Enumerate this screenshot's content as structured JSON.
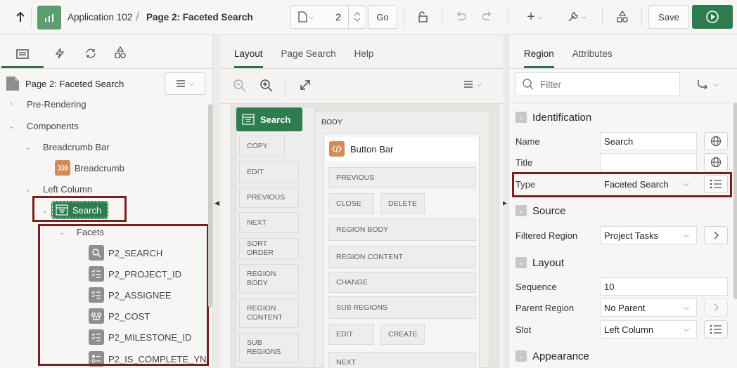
{
  "toolbar": {
    "app_name": "Application 102",
    "page_title": "Page 2: Faceted Search",
    "page_number": "2",
    "go_label": "Go",
    "save_label": "Save"
  },
  "left": {
    "tabs": [
      "rendering-icon",
      "dynamic-actions-icon",
      "processing-icon",
      "shared-components-icon"
    ],
    "root_label": "Page 2: Faceted Search",
    "tree": {
      "pre_rendering": "Pre-Rendering",
      "components": "Components",
      "breadcrumb_bar": "Breadcrumb Bar",
      "breadcrumb": "Breadcrumb",
      "left_column": "Left Column",
      "search": "Search",
      "facets": "Facets",
      "facet_items": [
        "P2_SEARCH",
        "P2_PROJECT_ID",
        "P2_ASSIGNEE",
        "P2_COST",
        "P2_MILESTONE_ID",
        "P2_IS_COMPLETE_YN"
      ]
    }
  },
  "center": {
    "tabs": [
      "Layout",
      "Page Search",
      "Help"
    ],
    "search_region": "Search",
    "search_slots": [
      "COPY",
      "EDIT",
      "PREVIOUS",
      "NEXT",
      "SORT ORDER",
      "REGION BODY",
      "REGION CONTENT",
      "SUB REGIONS"
    ],
    "body_label": "BODY",
    "button_bar": "Button Bar",
    "button_bar_slots": {
      "previous": "PREVIOUS",
      "close": "CLOSE",
      "delete": "DELETE",
      "region_body": "REGION BODY",
      "region_content": "REGION CONTENT",
      "change": "CHANGE",
      "sub_regions": "SUB REGIONS",
      "edit": "EDIT",
      "create": "CREATE",
      "next": "NEXT"
    }
  },
  "right": {
    "tabs": [
      "Region",
      "Attributes"
    ],
    "filter_placeholder": "Filter",
    "sections": {
      "identification": "Identification",
      "source": "Source",
      "layout": "Layout",
      "appearance": "Appearance"
    },
    "props": {
      "name_label": "Name",
      "name_value": "Search",
      "title_label": "Title",
      "title_value": "",
      "type_label": "Type",
      "type_value": "Faceted Search",
      "filtered_region_label": "Filtered Region",
      "filtered_region_value": "Project Tasks",
      "sequence_label": "Sequence",
      "sequence_value": "10",
      "parent_region_label": "Parent Region",
      "parent_region_value": "No Parent",
      "slot_label": "Slot",
      "slot_value": "Left Column"
    }
  },
  "colors": {
    "accent_green": "#2f7d4f",
    "highlight_red": "#7a1f21"
  }
}
